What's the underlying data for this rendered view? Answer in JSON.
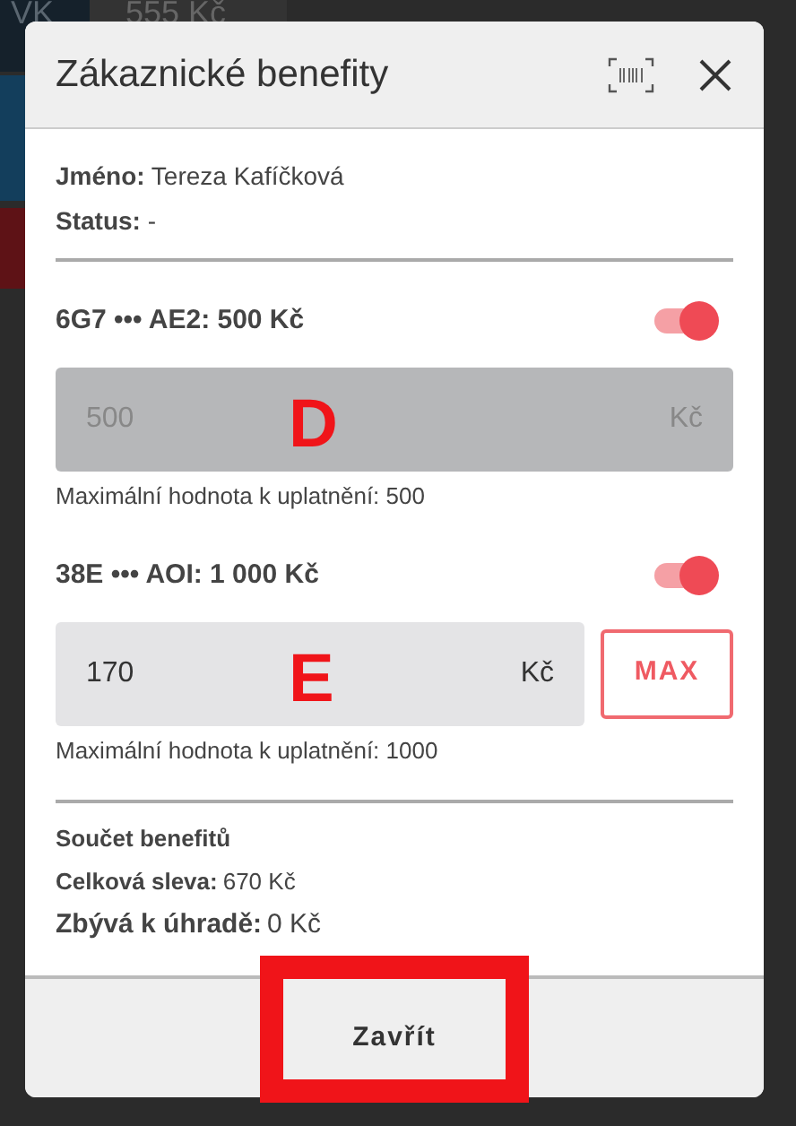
{
  "background": {
    "cells": [
      {
        "text": "VK"
      },
      {
        "text": "555 Kč"
      }
    ]
  },
  "dialog": {
    "title": "Zákaznické benefity",
    "info": [
      "**Jméno:** Tereza Kafíčková",
      "**Status:** -"
    ],
    "benefits": [
      {
        "title": "6G7 ••• AE2: 500 Kč",
        "on": true,
        "value": "500",
        "unit": "Kč",
        "disabled": true,
        "hint": "Maximální hodnota k uplatnění: 500",
        "annotation": "D"
      },
      {
        "title": "38E ••• AOI: 1 000 Kč",
        "on": true,
        "value": "170",
        "unit": "Kč",
        "disabled": false,
        "max_button": "MAX",
        "hint": "Maximální hodnota k uplatnění: 1000",
        "annotation": "E"
      }
    ],
    "summary": {
      "heading": "Součet benefitů",
      "lines": [
        {
          "label": "Celková sleva:",
          "value": "670 Kč",
          "kind": "normal"
        },
        {
          "label": "Zbývá k úhradě:",
          "value": "0 Kč",
          "kind": "large"
        }
      ]
    },
    "footer": {
      "button": "Zavřít",
      "highlighted": true
    }
  }
}
